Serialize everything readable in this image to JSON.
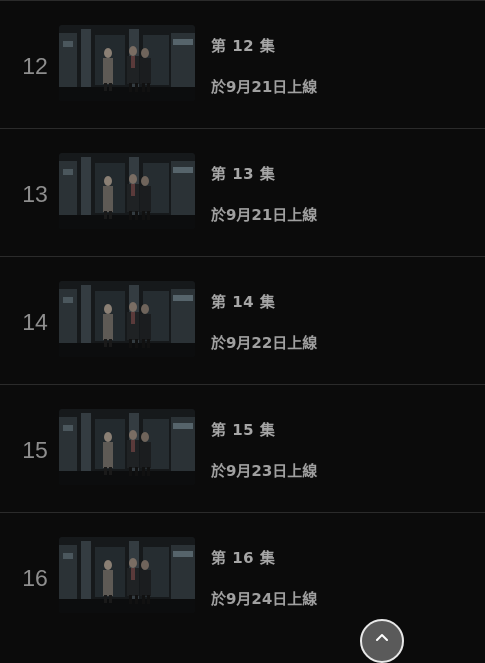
{
  "episodes": [
    {
      "index": "12",
      "title": "第 12 集",
      "date": "於9月21日上線",
      "thumbnail_icon": "episode-thumbnail"
    },
    {
      "index": "13",
      "title": "第 13 集",
      "date": "於9月21日上線",
      "thumbnail_icon": "episode-thumbnail"
    },
    {
      "index": "14",
      "title": "第 14 集",
      "date": "於9月22日上線",
      "thumbnail_icon": "episode-thumbnail"
    },
    {
      "index": "15",
      "title": "第 15 集",
      "date": "於9月23日上線",
      "thumbnail_icon": "episode-thumbnail"
    },
    {
      "index": "16",
      "title": "第 16 集",
      "date": "於9月24日上線",
      "thumbnail_icon": "episode-thumbnail"
    }
  ],
  "scroll_top": {
    "icon": "chevron-up-icon"
  },
  "colors": {
    "background": "#0b0b0b",
    "divider": "#2b2b2b",
    "text": "#a6a6a6",
    "button_bg": "#5a5a5a",
    "button_border": "#e8e8e8"
  }
}
